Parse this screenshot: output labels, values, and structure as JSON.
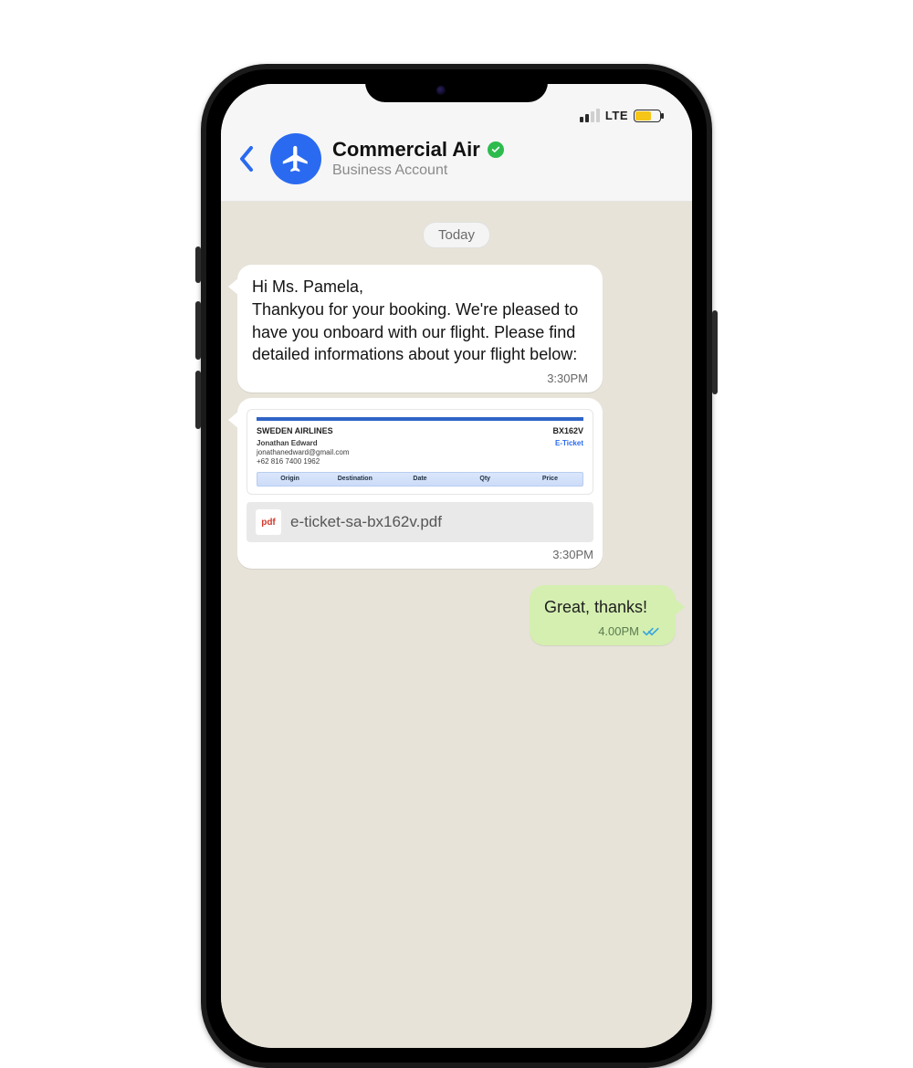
{
  "status": {
    "network_label": "LTE"
  },
  "header": {
    "contact_name": "Commercial Air",
    "subtitle": "Business Account"
  },
  "chat": {
    "date_label": "Today",
    "messages": {
      "m1": {
        "text": "Hi Ms. Pamela,\nThankyou for your booking. We're pleased to have you onboard with our flight. Please find detailed informations about your flight below:",
        "time": "3:30PM"
      },
      "m2": {
        "file_name": "e-ticket-sa-bx162v.pdf",
        "file_type_label": "pdf",
        "time": "3:30PM",
        "ticket": {
          "airline": "SWEDEN AIRLINES",
          "code": "BX162V",
          "passenger_name": "Jonathan Edward",
          "passenger_email": "jonathanedward@gmail.com",
          "passenger_phone": "+62 816 7400 1962",
          "eticket_label": "E-Ticket",
          "col_origin": "Origin",
          "col_destination": "Destination",
          "col_date": "Date",
          "col_qty": "Qty",
          "col_price": "Price"
        }
      },
      "m3": {
        "text": "Great, thanks!",
        "time": "4.00PM"
      }
    }
  }
}
